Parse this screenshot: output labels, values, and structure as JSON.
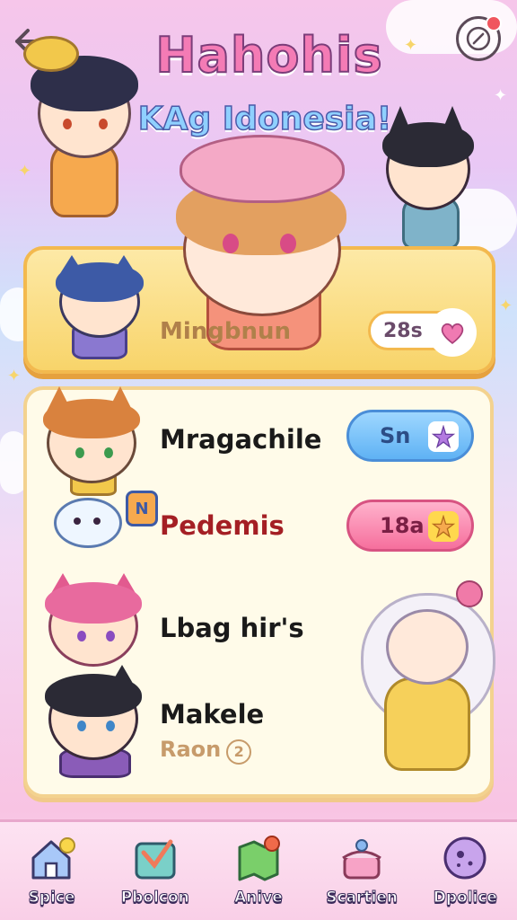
{
  "header": {
    "title": "Hahohis",
    "subtitle": "KAg Idonesia!",
    "back_icon": "back-arrow-icon",
    "compass_icon": "compass-icon"
  },
  "featured": {
    "name": "Mingbnun",
    "badge_value": "28s",
    "badge_icon": "heart-icon"
  },
  "list": {
    "rows": [
      {
        "name": "Mragachile",
        "pill_value": "Sn",
        "pill_color": "blue",
        "pill_icon": "star-icon"
      },
      {
        "name": "Pedemis",
        "pill_value": "18a",
        "pill_color": "pink",
        "pill_icon": "star-icon"
      },
      {
        "name": "Lbag hir's"
      },
      {
        "name": "Makele",
        "sub_label": "Raon",
        "sub_count": "2"
      }
    ]
  },
  "nav": {
    "items": [
      {
        "label": "Spice",
        "icon": "house-icon"
      },
      {
        "label": "Pbolcon",
        "icon": "box-icon"
      },
      {
        "label": "Anive",
        "icon": "map-icon"
      },
      {
        "label": "Scartien",
        "icon": "cake-icon"
      },
      {
        "label": "Dpolice",
        "icon": "cookie-icon"
      }
    ]
  },
  "colors": {
    "accent_pink": "#f47bb5",
    "accent_gold": "#f3b94e",
    "pill_blue": "#5fb2f4",
    "pill_pink": "#f66f9d"
  }
}
